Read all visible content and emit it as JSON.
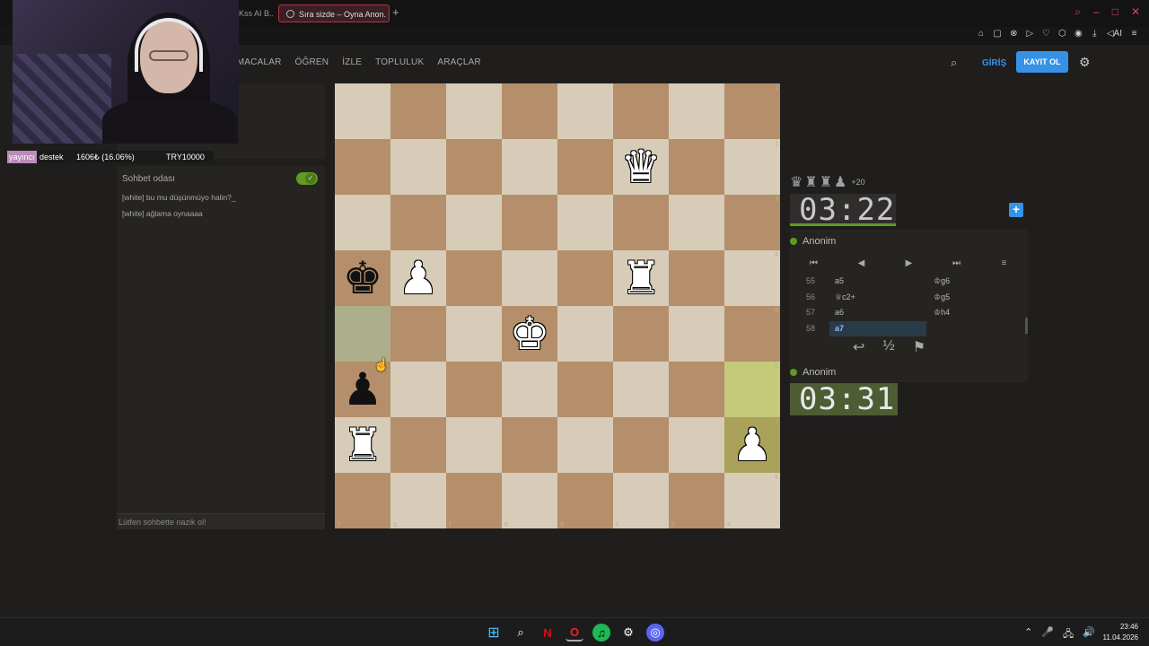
{
  "browser": {
    "tabs": [
      {
        "label": "Kss AI B..."
      },
      {
        "label": "Sıra sizde – Oyna Anon. •"
      }
    ],
    "add_tab": "+",
    "win_controls": [
      "–",
      "□",
      "✕"
    ],
    "toolbar_icons": [
      "⌂",
      "▢",
      "⊗",
      "▷",
      "♡",
      "⬡",
      "◉",
      "⤓",
      "◁AI",
      "≡"
    ]
  },
  "header": {
    "nav": [
      "LMACALAR",
      "ÖĞREN",
      "İZLE",
      "TOPLULUK",
      "ARAÇLAR"
    ],
    "search_icon": "⌕",
    "login": "GİRİŞ",
    "signup": "KAYIT OL",
    "settings_icon": "⚙"
  },
  "stream": {
    "donation_label": "yayıncı destek",
    "donation_label_a": "yayıncı",
    "donation_label_b": "destek",
    "donation_amount": "1606₺ (16.06%)",
    "donation_goal": "TRY10000"
  },
  "chat": {
    "title": "Sohbet odası",
    "messages": [
      "[white] bu mu düşünmüyo halin?_",
      "[white] ağlama oynaaaa"
    ],
    "placeholder": "Lütfen sohbette nazik ol!"
  },
  "board": {
    "orientation": "black",
    "rank_labels": [
      "1",
      "2",
      "3",
      "4",
      "5",
      "6",
      "7",
      "8"
    ],
    "file_labels": [
      "h",
      "g",
      "f",
      "e",
      "d",
      "c",
      "b",
      "a"
    ],
    "pieces": [
      {
        "square": "c2",
        "piece": "♛",
        "color": "w"
      },
      {
        "square": "h4",
        "piece": "♚",
        "color": "b"
      },
      {
        "square": "g4",
        "piece": "♟",
        "color": "w"
      },
      {
        "square": "c4",
        "piece": "♜",
        "color": "w"
      },
      {
        "square": "e5",
        "piece": "♚",
        "color": "w"
      },
      {
        "square": "h6",
        "piece": "♟",
        "color": "b"
      },
      {
        "square": "h7",
        "piece": "♜",
        "color": "w"
      },
      {
        "square": "a7",
        "piece": "♟",
        "color": "w"
      }
    ],
    "highlights": [
      "a6",
      "a7",
      "h5"
    ]
  },
  "game": {
    "material_icons": [
      "♛",
      "♜",
      "♜",
      "♟"
    ],
    "material_diff": "+20",
    "top_player": "Anonim",
    "top_clock_min": "03",
    "top_clock_sec": "22",
    "bottom_player": "Anonim",
    "bottom_clock_min": "03",
    "bottom_clock_sec": "31",
    "controls": [
      "⏮",
      "◀",
      "▶",
      "⏭",
      "≡"
    ],
    "moves": [
      {
        "no": "55",
        "w": "a5",
        "b": "♔g6"
      },
      {
        "no": "56",
        "w": "♕c2+",
        "b": "♔g5"
      },
      {
        "no": "57",
        "w": "a6",
        "b": "♔h4"
      },
      {
        "no": "58",
        "w": "a7",
        "b": ""
      }
    ],
    "actions": [
      "↩",
      "½",
      "⚑"
    ]
  },
  "taskbar": {
    "apps": [
      "⊞",
      "⌕",
      "N",
      "O",
      "♫",
      "⚙",
      "◎"
    ],
    "tray": [
      "⌃",
      "🎤",
      "🖧",
      "🔊"
    ],
    "time": "23:46",
    "date": "11.04.2026"
  },
  "colors": {
    "accent": "#3692e7",
    "green": "#629924",
    "light_sq": "#d6ccb7",
    "dark_sq": "#b58f6b"
  }
}
